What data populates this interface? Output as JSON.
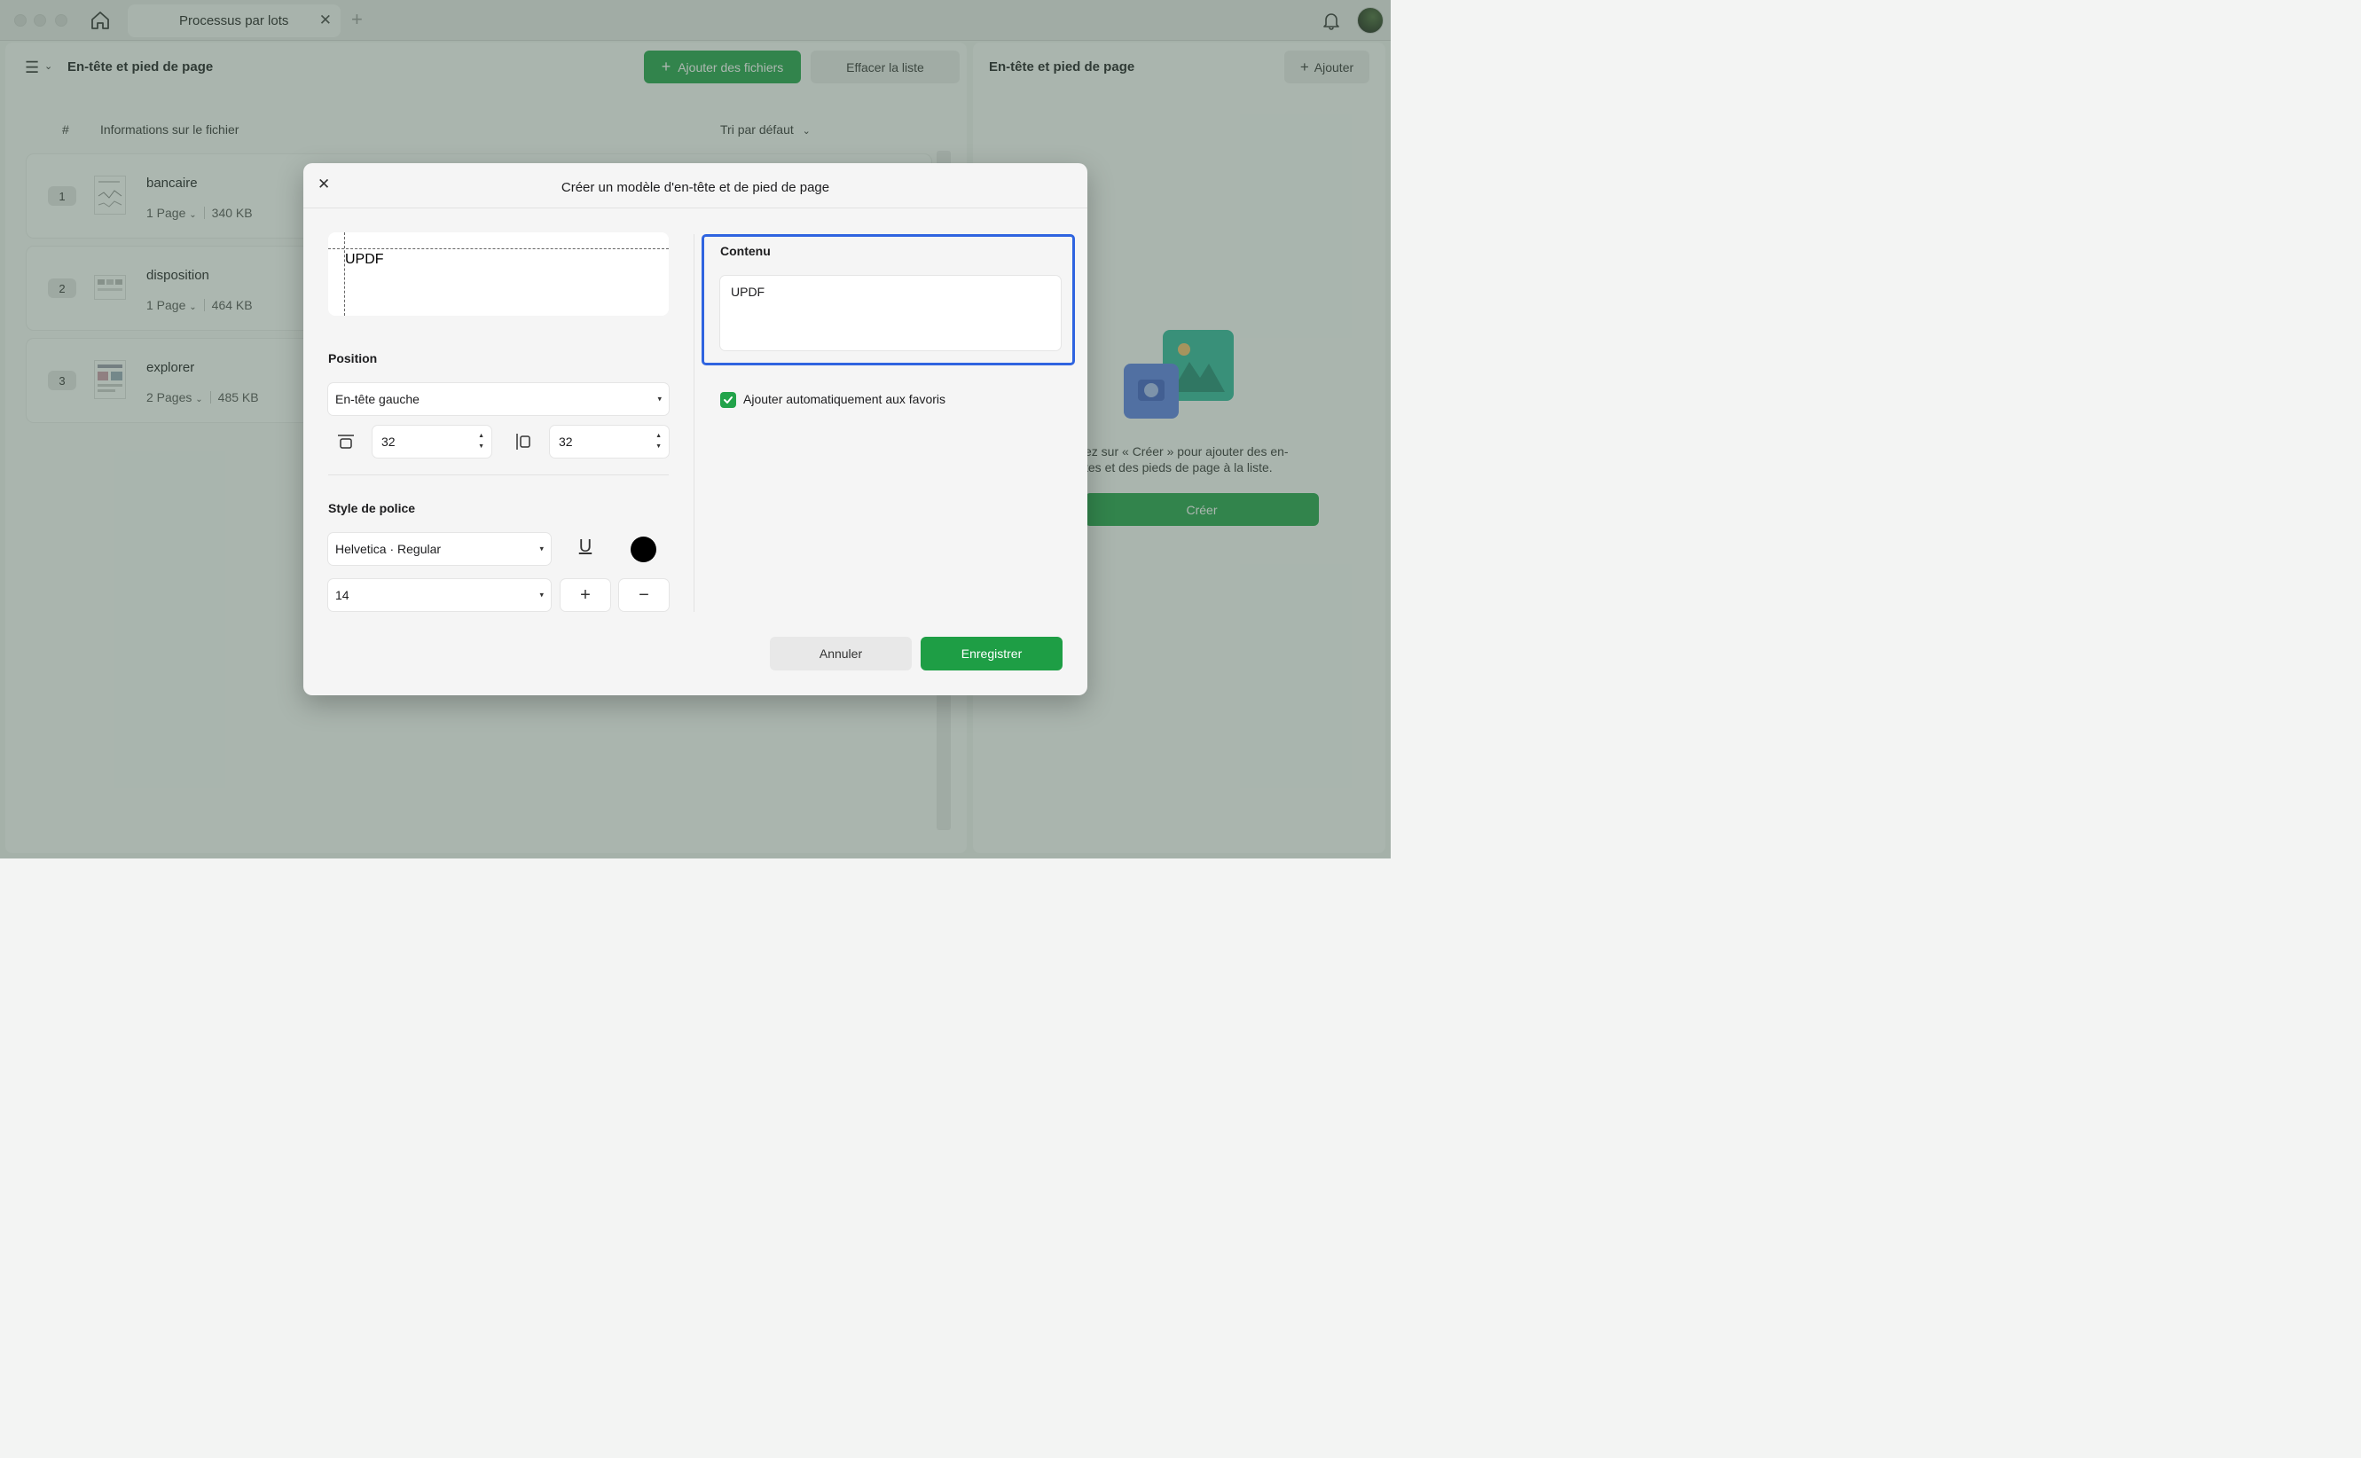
{
  "tab": {
    "title": "Processus par lots",
    "close": "✕",
    "new_tab": "+"
  },
  "left_panel": {
    "menu_icon": "☰",
    "menu_caret": "⌄",
    "title": "En-tête et pied de page",
    "add_files_label": "Ajouter des fichiers",
    "add_files_icon": "+",
    "clear_label": "Effacer la liste",
    "columns": {
      "index": "#",
      "info": "Informations sur le fichier"
    },
    "sort_label": "Tri par défaut",
    "sort_caret": "⌄",
    "files": [
      {
        "index": "1",
        "name": "bancaire",
        "pages": "1 Page",
        "size": "340 KB"
      },
      {
        "index": "2",
        "name": "disposition",
        "pages": "1 Page",
        "size": "464 KB"
      },
      {
        "index": "3",
        "name": "explorer",
        "pages": "2 Pages",
        "size": "485 KB"
      }
    ],
    "page_caret": "⌄"
  },
  "right_panel": {
    "title": "En-tête et pied de page",
    "add_label": "Ajouter",
    "add_icon": "+",
    "hint_line1": "ez sur « Créer » pour ajouter des en-",
    "hint_line2": "tes et des pieds de page à la liste.",
    "create_label": "Créer"
  },
  "dialog": {
    "close": "✕",
    "title": "Créer un modèle d'en-tête et de pied de page",
    "preview_text": "UPDF",
    "position_label": "Position",
    "position_value": "En-tête gauche",
    "margin_top": "32",
    "margin_side": "32",
    "font_style_label": "Style de police",
    "font_value": "Helvetica · Regular",
    "underline_glyph": "U",
    "size_value": "14",
    "plus": "+",
    "minus": "−",
    "content_label": "Contenu",
    "content_value": "UPDF",
    "auto_fav_label": "Ajouter automatiquement aux favoris",
    "cancel_label": "Annuler",
    "save_label": "Enregistrer",
    "dropdown_caret": "▾",
    "stepper_arrows_up": "▲",
    "stepper_arrows_down": "▼"
  },
  "colors": {
    "accent_green": "#22a34a",
    "focus_blue": "#2f64e0",
    "font_color": "#000000"
  }
}
